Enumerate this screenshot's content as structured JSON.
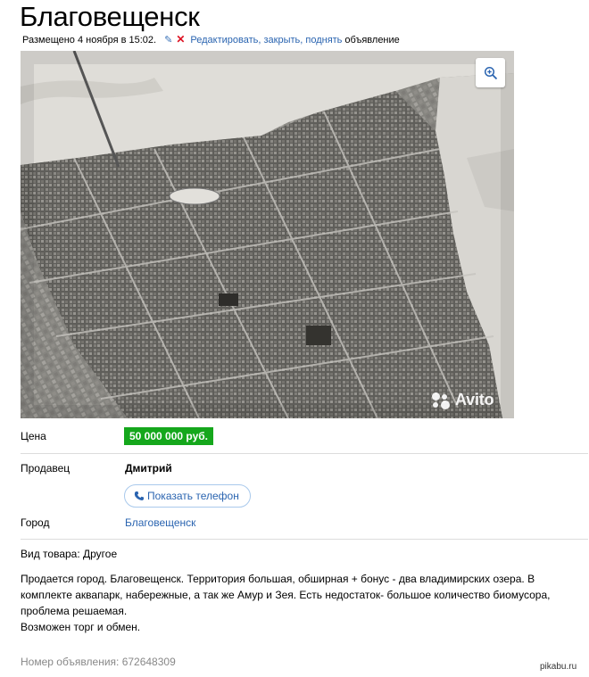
{
  "ad": {
    "title": "Благовещенск",
    "posted": "Размещено 4 ноября в 15:02.",
    "edit_links": "Редактировать, закрыть, поднять",
    "edit_tail": "объявление"
  },
  "photo": {
    "watermark": "Avito",
    "zoom_icon": "zoom-in-icon"
  },
  "details": {
    "price_label": "Цена",
    "price_value": "50 000 000 руб.",
    "seller_label": "Продавец",
    "seller_name": "Дмитрий",
    "phone_button": "Показать телефон",
    "city_label": "Город",
    "city_value": "Благовещенск"
  },
  "description": {
    "category": "Вид товара: Другое",
    "text": "Продается город. Благовещенск. Территория большая, обширная + бонус - два владимирских озера. В комплекте аквапарк, набережные, а так же Амур и Зея. Есть недостаток- большое количество биомусора, проблема решаемая.",
    "extra": "Возможен торг и обмен."
  },
  "footer": {
    "ad_number": "Номер объявления: 672648309",
    "source": "pikabu.ru"
  },
  "colors": {
    "price_bg": "#15a71c",
    "link": "#2a64b0"
  }
}
